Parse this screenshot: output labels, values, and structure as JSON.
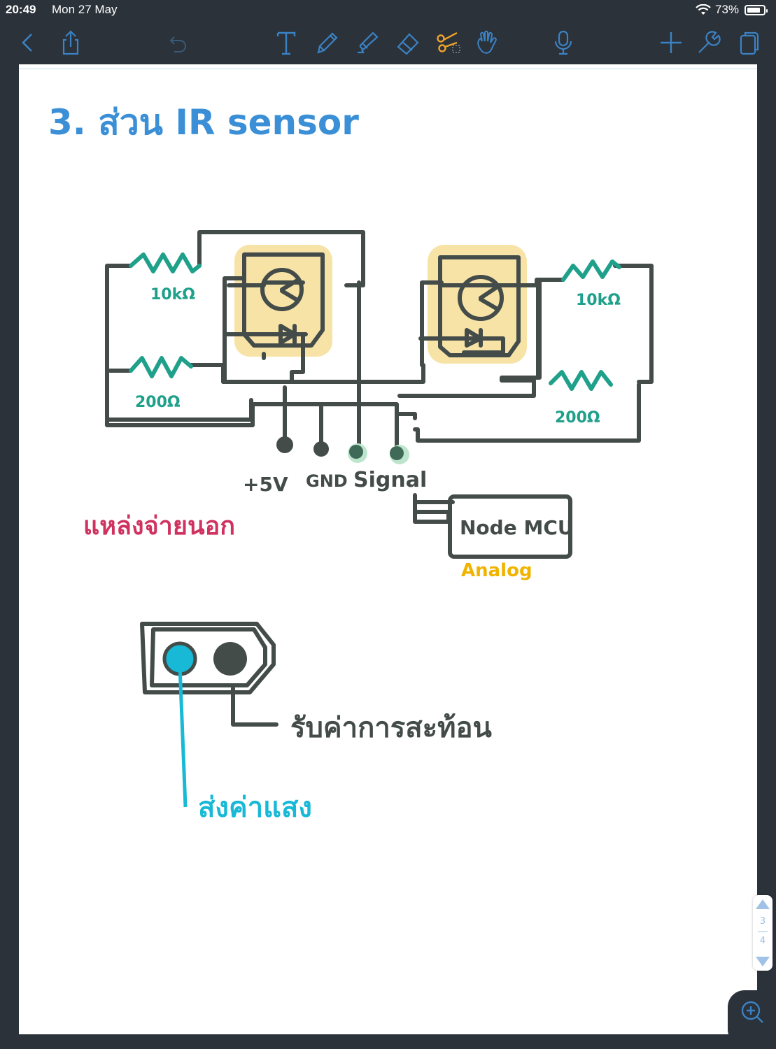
{
  "status_bar": {
    "time": "20:49",
    "date": "Mon 27 May",
    "battery_percent": "73%",
    "battery_level": 0.73
  },
  "toolbar": {
    "icons": [
      "back-chevron-icon",
      "share-icon",
      "undo-icon",
      "text-tool-icon",
      "pen-tool-icon",
      "highlighter-tool-icon",
      "eraser-tool-icon",
      "lasso-scissors-icon",
      "hand-pointer-icon",
      "microphone-icon",
      "add-icon",
      "wrench-icon",
      "pages-icon"
    ],
    "accent_color": "#3b82c4",
    "active_tool_color": "#f0a32b"
  },
  "note": {
    "title": "3. ส่วน IR sensor",
    "resistor_left_top": "10kΩ",
    "resistor_left_bottom": "200Ω",
    "resistor_right_top": "10kΩ",
    "resistor_right_bottom": "200Ω",
    "pin_5v": "+5V",
    "pin_gnd": "GND",
    "pin_signal": "Signal",
    "external_supply": "แหล่งจ่ายนอก",
    "module": "Node MCU",
    "module_mode": "Analog",
    "receiver_label": "รับค่าการสะท้อน",
    "emitter_label": "ส่งค่าแสง",
    "colors": {
      "title": "#3a8fd6",
      "wire": "#444c4a",
      "resistor": "#1fa08a",
      "highlight": "#f5d98a",
      "supply": "#d0325f",
      "analog": "#f0b400",
      "emitter": "#17b9d6"
    }
  },
  "pager": {
    "current_page": "3",
    "next_page": "4"
  }
}
